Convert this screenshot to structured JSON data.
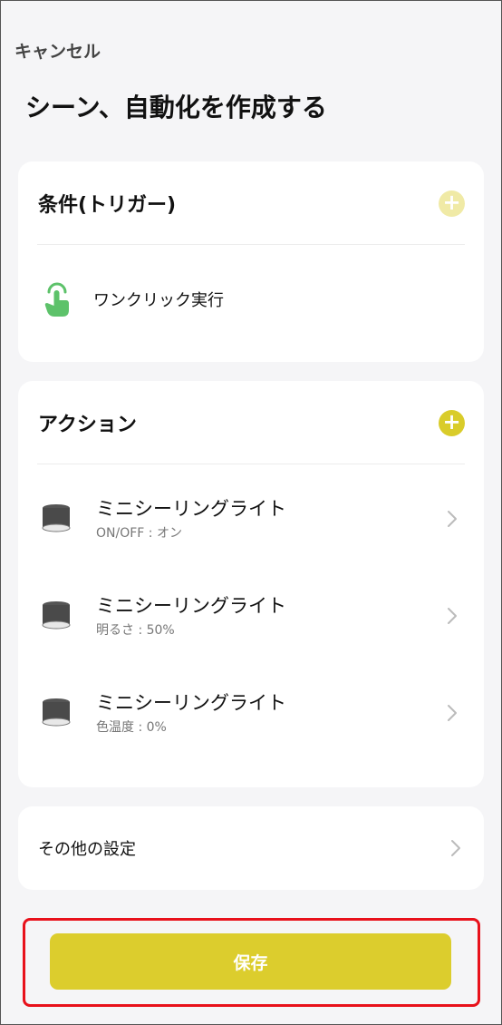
{
  "header": {
    "cancel_label": "キャンセル",
    "title": "シーン、自動化を作成する"
  },
  "trigger_card": {
    "title": "条件(トリガー)",
    "add_icon": "plus-icon",
    "add_state": "disabled",
    "item": {
      "icon": "tap-hand-icon",
      "label": "ワンクリック実行"
    }
  },
  "action_card": {
    "title": "アクション",
    "add_icon": "plus-icon",
    "items": [
      {
        "icon": "ceiling-light-icon",
        "name": "ミニシーリングライト",
        "detail": "ON/OFF : オン"
      },
      {
        "icon": "ceiling-light-icon",
        "name": "ミニシーリングライト",
        "detail": "明るさ : 50%"
      },
      {
        "icon": "ceiling-light-icon",
        "name": "ミニシーリングライト",
        "detail": "色温度 : 0%"
      }
    ]
  },
  "other_card": {
    "label": "その他の設定"
  },
  "save_label": "保存",
  "colors": {
    "accent": "#dccd2d",
    "accent_disabled": "#f0eaa6",
    "highlight_outline": "#e8111b",
    "tap_icon": "#5dc26a",
    "background": "#f5f5f7"
  }
}
